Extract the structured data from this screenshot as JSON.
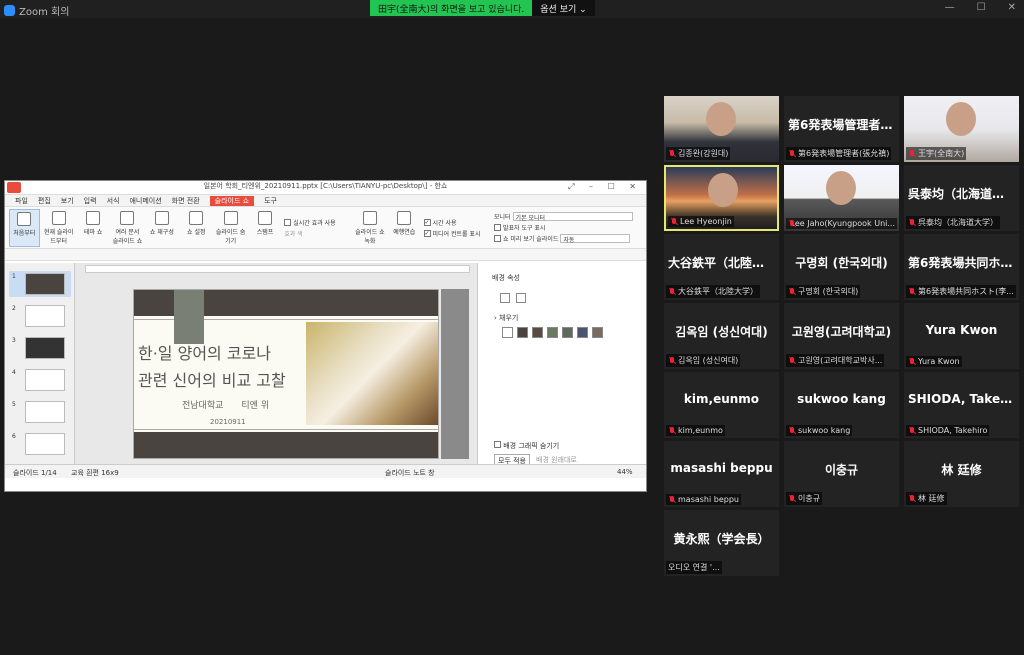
{
  "window": {
    "title": "Zoom 회의",
    "banner_text": "田宇(全南大)의 화면을 보고 있습니다.",
    "view_options": "옵션 보기"
  },
  "shared": {
    "doc_title": "일본어 학회_티엔위_20210911.pptx [C:\\Users\\TIANYU-pc\\Desktop\\] - 한쇼",
    "menu": [
      "파일",
      "편집",
      "보기",
      "입력",
      "서식",
      "애니메이션",
      "화면 전환",
      "슬라이드 쇼",
      "도구"
    ],
    "ribbon": [
      "처음부터",
      "현재 슬라이드부터",
      "테마 쇼",
      "여러 문서 슬라이드 쇼",
      "쇼 재구성",
      "쇼 설정",
      "슬라이드 숨기기",
      "스탬프"
    ],
    "ribbon_checks": [
      "실시간 효과 사용",
      "효과 색",
      "시간 사용",
      "미디어 컨트롤 표시",
      "발표자 도구 표시",
      "쇼 미리 보기 슬라이드"
    ],
    "ribbon_right": [
      "슬라이드 쇼 녹화",
      "예행연습"
    ],
    "monitor_label": "모니터",
    "monitor_value": "기본 모니터",
    "auto_value": "자동",
    "slide": {
      "title1": "한·일 양어의 코로나",
      "title2": "관련 신어의 비교 고찰",
      "author": "전남대학교　　티엔 위",
      "date": "20210911"
    },
    "panel": {
      "title": "배경 속성",
      "fill": "채우기",
      "hide_graphics": "배경 그래픽 숨기기",
      "apply_all": "모두 적용",
      "reset": "배경 원래대로"
    },
    "swatches": [
      "#ffffff",
      "#4a4440",
      "#5a4a44",
      "#6a7a62",
      "#5c6a5a",
      "#4a5470",
      "#7a6a60"
    ],
    "status": {
      "slide": "슬라이드 1/14",
      "theme": "교육 흰편 16x9",
      "notes": "슬라이드 노트 창",
      "zoom": "44%"
    }
  },
  "tiles": [
    {
      "name": "김종완(강원대)",
      "video": "vid1"
    },
    {
      "name": "第6発表場管理者(張允禛)",
      "big": "第6発表場管理者(張允禛)"
    },
    {
      "name": "王宇(全南大)",
      "video": "vid2"
    },
    {
      "name": "Lee Hyeonjin",
      "video": "vid3",
      "active": true
    },
    {
      "name": "Lee Jaho(Kyungpook Uni...",
      "video": "vid4"
    },
    {
      "name": "呉泰均（北海道大学）",
      "big": "呉泰均（北海道大学）"
    },
    {
      "name": "大谷鉄平（北陸大学）",
      "big": "大谷鉄平（北陸大学）"
    },
    {
      "name": "구명회 (한국외대)",
      "big": "구명회 (한국외대)"
    },
    {
      "name": "第6発表場共同ホスト(李...",
      "big": "第6発表場共同ホスト"
    },
    {
      "name": "김옥임 (성신여대)",
      "big": "김옥임 (성신여대)"
    },
    {
      "name": "고원영(고려대학교박사...",
      "big": "고원영(고려대학교)"
    },
    {
      "name": "Yura Kwon",
      "big": "Yura Kwon"
    },
    {
      "name": "kim,eunmo",
      "big": "kim,eunmo"
    },
    {
      "name": "sukwoo kang",
      "big": "sukwoo kang"
    },
    {
      "name": "SHIODA, Takehiro",
      "big": "SHIODA, Takehiro"
    },
    {
      "name": "masashi beppu",
      "big": "masashi beppu"
    },
    {
      "name": "이충규",
      "big": "이충규"
    },
    {
      "name": "林 廷修",
      "big": "林 廷修"
    },
    {
      "name": "오디오 연결 '...",
      "big": "黄永熙（学会長）",
      "nomic": true
    }
  ]
}
